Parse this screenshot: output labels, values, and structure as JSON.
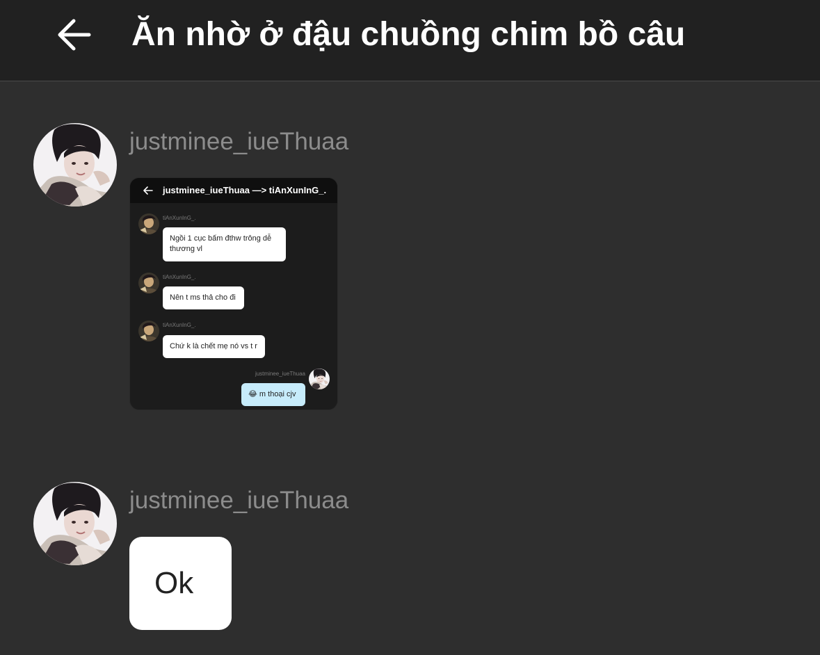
{
  "header": {
    "back_icon": "arrow-left-icon",
    "title": "Ăn nhờ ở đậu chuồng chim bồ câu"
  },
  "colors": {
    "background": "#2e2e2e",
    "header_bg": "#212121",
    "sender_name": "#8c8c8c",
    "own_bubble": "#c7ecfb"
  },
  "messages": [
    {
      "sender": "justminee_iueThuaa",
      "type": "image",
      "screenshot": {
        "title": "justminee_iueThuaa —> tiAnXunInG_.",
        "items": [
          {
            "name": "tiAnXunInG_.",
            "text": "Ngồi 1 cục bấm đthw trông dễ thương vl"
          },
          {
            "name": "tiAnXunInG_.",
            "text": "Nên t ms thả cho đi"
          },
          {
            "name": "tiAnXunInG_.",
            "text": "Chứ k là chết mẹ nó vs t r"
          },
          {
            "name": "justminee_iueThuaa",
            "emoji": "😂",
            "text": "m thoại cjv"
          }
        ]
      }
    },
    {
      "sender": "justminee_iueThuaa",
      "type": "text",
      "text": "Ok"
    }
  ]
}
